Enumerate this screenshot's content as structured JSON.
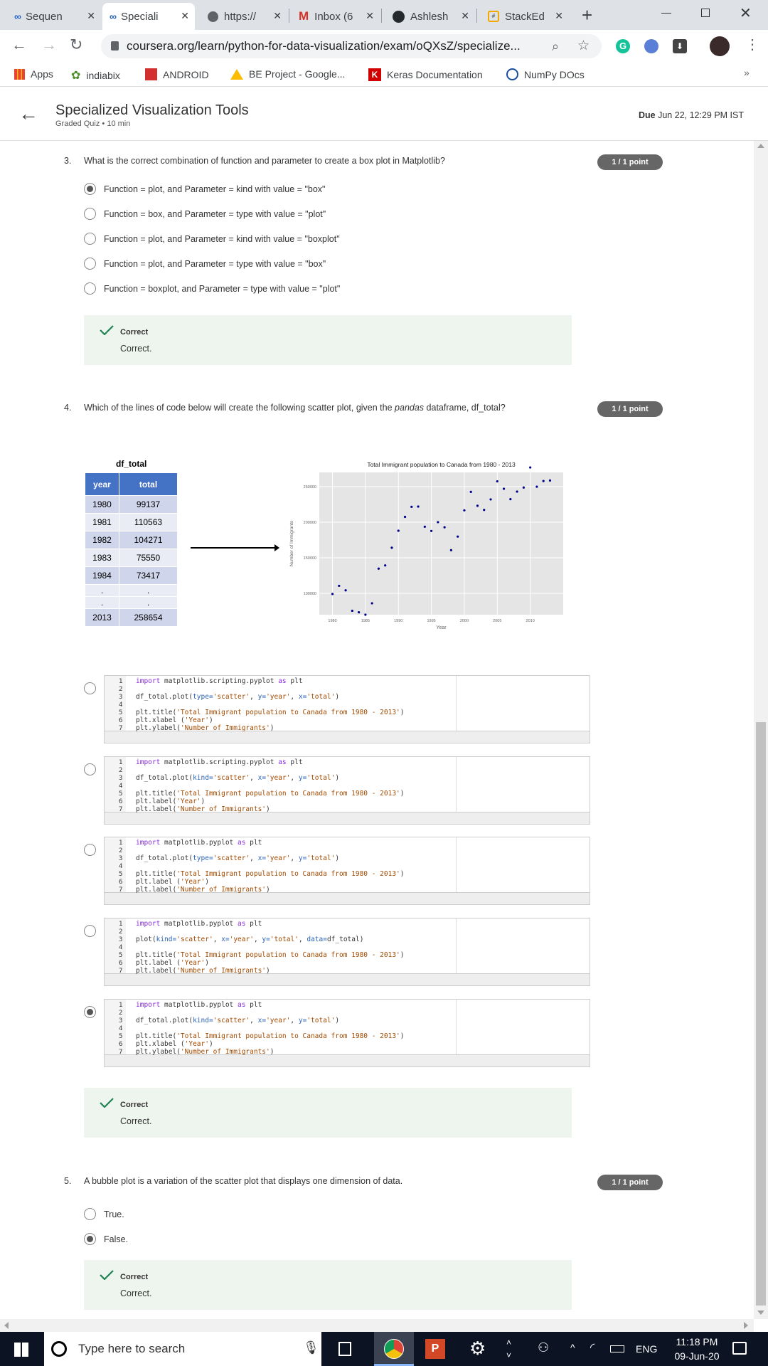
{
  "browser": {
    "tabs": [
      {
        "label": "Sequen",
        "icon": "coursera-icon"
      },
      {
        "label": "Speciali",
        "icon": "coursera-icon"
      },
      {
        "label": "https://",
        "icon": "globe-icon"
      },
      {
        "label": "Inbox (6",
        "icon": "gmail-icon"
      },
      {
        "label": "Ashlesh",
        "icon": "github-icon"
      },
      {
        "label": "StackEd",
        "icon": "stackedit-icon"
      }
    ],
    "url": "coursera.org/learn/python-for-data-visualization/exam/oQXsZ/specialize...",
    "bookmarks": [
      {
        "label": "Apps",
        "icon": "apps-grid-icon"
      },
      {
        "label": "indiabix",
        "icon": "indiabix-icon"
      },
      {
        "label": "ANDROID",
        "icon": "android-bookmark-icon"
      },
      {
        "label": "BE Project - Google...",
        "icon": "google-drive-icon"
      },
      {
        "label": "Keras Documentation",
        "icon": "keras-icon"
      },
      {
        "label": "NumPy DOcs",
        "icon": "numpy-icon"
      }
    ]
  },
  "header": {
    "title": "Specialized Visualization Tools",
    "subtitle": "Graded Quiz • 10 min",
    "due_label": "Due",
    "due_value": "Jun 22, 12:29 PM IST"
  },
  "q3": {
    "number": "3.",
    "text": "What is the correct combination of function and parameter to create a box plot in Matplotlib?",
    "badge": "1 / 1 point",
    "options": [
      "Function = plot, and Parameter = kind with value = \"box\"",
      "Function = box, and Parameter = type with value = \"plot\"",
      "Function = plot, and Parameter = kind with value = \"boxplot\"",
      "Function = plot, and Parameter = type with value = \"box\"",
      "Function = boxplot, and Parameter = type with value = \"plot\""
    ],
    "selected": 0,
    "feedback_title": "Correct",
    "feedback_detail": "Correct."
  },
  "q4": {
    "number": "4.",
    "text_pre": "Which of the lines of code below will create the following scatter plot, given the ",
    "text_em": "pandas",
    "text_post": " dataframe, df_total?",
    "badge": "1 / 1 point",
    "table": {
      "title": "df_total",
      "headers": [
        "year",
        "total"
      ],
      "rows": [
        [
          "1980",
          "99137"
        ],
        [
          "1981",
          "110563"
        ],
        [
          "1982",
          "104271"
        ],
        [
          "1983",
          "75550"
        ],
        [
          "1984",
          "73417"
        ]
      ],
      "ellipsis": "."
    },
    "last_row": [
      "2013",
      "258654"
    ],
    "selected": 4,
    "feedback_title": "Correct",
    "feedback_detail": "Correct.",
    "code_options": [
      [
        [
          [
            "kw",
            "import"
          ],
          [
            "t",
            " matplotlib.scripting.pyplot "
          ],
          [
            "kw",
            "as"
          ],
          [
            "t",
            " plt"
          ]
        ],
        [],
        [
          [
            "t",
            "df_total.plot("
          ],
          [
            "ar",
            "type="
          ],
          [
            "str",
            "'scatter'"
          ],
          [
            "t",
            ", "
          ],
          [
            "ar",
            "y="
          ],
          [
            "str",
            "'year'"
          ],
          [
            "t",
            ", "
          ],
          [
            "ar",
            "x="
          ],
          [
            "str",
            "'total'"
          ],
          [
            "t",
            ")"
          ]
        ],
        [],
        [
          [
            "t",
            "plt.title("
          ],
          [
            "str",
            "'Total Immigrant population to Canada from 1980 - 2013'"
          ],
          [
            "t",
            ")"
          ]
        ],
        [
          [
            "t",
            "plt.xlabel ("
          ],
          [
            "str",
            "'Year'"
          ],
          [
            "t",
            ")"
          ]
        ],
        [
          [
            "t",
            "plt.ylabel("
          ],
          [
            "str",
            "'Number of Immigrants'"
          ],
          [
            "t",
            ")"
          ]
        ]
      ],
      [
        [
          [
            "kw",
            "import"
          ],
          [
            "t",
            " matplotlib.scripting.pyplot "
          ],
          [
            "kw",
            "as"
          ],
          [
            "t",
            " plt"
          ]
        ],
        [],
        [
          [
            "t",
            "df_total.plot("
          ],
          [
            "ar",
            "kind="
          ],
          [
            "str",
            "'scatter'"
          ],
          [
            "t",
            ", "
          ],
          [
            "ar",
            "x="
          ],
          [
            "str",
            "'year'"
          ],
          [
            "t",
            ", "
          ],
          [
            "ar",
            "y="
          ],
          [
            "str",
            "'total'"
          ],
          [
            "t",
            ")"
          ]
        ],
        [],
        [
          [
            "t",
            "plt.title("
          ],
          [
            "str",
            "'Total Immigrant population to Canada from 1980 - 2013'"
          ],
          [
            "t",
            ")"
          ]
        ],
        [
          [
            "t",
            "plt.label("
          ],
          [
            "str",
            "'Year'"
          ],
          [
            "t",
            ")"
          ]
        ],
        [
          [
            "t",
            "plt.label("
          ],
          [
            "str",
            "'Number of Immigrants'"
          ],
          [
            "t",
            ")"
          ]
        ]
      ],
      [
        [
          [
            "kw",
            "import"
          ],
          [
            "t",
            " matplotlib.pyplot "
          ],
          [
            "kw",
            "as"
          ],
          [
            "t",
            " plt"
          ]
        ],
        [],
        [
          [
            "t",
            "df_total.plot("
          ],
          [
            "ar",
            "type="
          ],
          [
            "str",
            "'scatter'"
          ],
          [
            "t",
            ", "
          ],
          [
            "ar",
            "x="
          ],
          [
            "str",
            "'year'"
          ],
          [
            "t",
            ", "
          ],
          [
            "ar",
            "y="
          ],
          [
            "str",
            "'total'"
          ],
          [
            "t",
            ")"
          ]
        ],
        [],
        [
          [
            "t",
            "plt.title("
          ],
          [
            "str",
            "'Total Immigrant population to Canada from 1980 - 2013'"
          ],
          [
            "t",
            ")"
          ]
        ],
        [
          [
            "t",
            "plt.label ("
          ],
          [
            "str",
            "'Year'"
          ],
          [
            "t",
            ")"
          ]
        ],
        [
          [
            "t",
            "plt.label("
          ],
          [
            "str",
            "'Number of Immigrants'"
          ],
          [
            "t",
            ")"
          ]
        ]
      ],
      [
        [
          [
            "kw",
            "import"
          ],
          [
            "t",
            " matplotlib.pyplot "
          ],
          [
            "kw",
            "as"
          ],
          [
            "t",
            " plt"
          ]
        ],
        [],
        [
          [
            "t",
            "plot("
          ],
          [
            "ar",
            "kind="
          ],
          [
            "str",
            "'scatter'"
          ],
          [
            "t",
            ", "
          ],
          [
            "ar",
            "x="
          ],
          [
            "str",
            "'year'"
          ],
          [
            "t",
            ", "
          ],
          [
            "ar",
            "y="
          ],
          [
            "str",
            "'total'"
          ],
          [
            "t",
            ", "
          ],
          [
            "ar",
            "data="
          ],
          [
            "t",
            "df_total)"
          ]
        ],
        [],
        [
          [
            "t",
            "plt.title("
          ],
          [
            "str",
            "'Total Immigrant population to Canada from 1980 - 2013'"
          ],
          [
            "t",
            ")"
          ]
        ],
        [
          [
            "t",
            "plt.label ("
          ],
          [
            "str",
            "'Year'"
          ],
          [
            "t",
            ")"
          ]
        ],
        [
          [
            "t",
            "plt.label("
          ],
          [
            "str",
            "'Number of Immigrants'"
          ],
          [
            "t",
            ")"
          ]
        ]
      ],
      [
        [
          [
            "kw",
            "import"
          ],
          [
            "t",
            " matplotlib.pyplot "
          ],
          [
            "kw",
            "as"
          ],
          [
            "t",
            " plt"
          ]
        ],
        [],
        [
          [
            "t",
            "df_total.plot("
          ],
          [
            "ar",
            "kind="
          ],
          [
            "str",
            "'scatter'"
          ],
          [
            "t",
            ", "
          ],
          [
            "ar",
            "x="
          ],
          [
            "str",
            "'year'"
          ],
          [
            "t",
            ", "
          ],
          [
            "ar",
            "y="
          ],
          [
            "str",
            "'total'"
          ],
          [
            "t",
            ")"
          ]
        ],
        [],
        [
          [
            "t",
            "plt.title("
          ],
          [
            "str",
            "'Total Immigrant population to Canada from 1980 - 2013'"
          ],
          [
            "t",
            ")"
          ]
        ],
        [
          [
            "t",
            "plt.xlabel ("
          ],
          [
            "str",
            "'Year'"
          ],
          [
            "t",
            ")"
          ]
        ],
        [
          [
            "t",
            "plt.ylabel("
          ],
          [
            "str",
            "'Number of Immigrants'"
          ],
          [
            "t",
            ")"
          ]
        ]
      ]
    ]
  },
  "q5": {
    "number": "5.",
    "text": "A bubble plot is a variation of the scatter plot that displays one dimension of data.",
    "badge": "1 / 1 point",
    "options": [
      "True.",
      "False."
    ],
    "selected": 1,
    "feedback_title": "Correct",
    "feedback_detail": "Correct."
  },
  "chart_data": {
    "type": "scatter",
    "title": "Total Immigrant population to Canada from 1980 - 2013",
    "xlabel": "Year",
    "ylabel": "Number of Immigrants",
    "xlim": [
      1978,
      2015
    ],
    "ylim": [
      70000,
      270000
    ],
    "xticks": [
      1980,
      1985,
      1990,
      1995,
      2000,
      2005,
      2010
    ],
    "yticks": [
      100000,
      150000,
      200000,
      250000
    ],
    "grid": true,
    "point_color": "#00008b",
    "x": [
      1980,
      1981,
      1982,
      1983,
      1984,
      1985,
      1986,
      1987,
      1988,
      1989,
      1990,
      1991,
      1992,
      1993,
      1994,
      1995,
      1996,
      1997,
      1998,
      1999,
      2000,
      2001,
      2002,
      2003,
      2004,
      2005,
      2006,
      2007,
      2008,
      2009,
      2010,
      2011,
      2012,
      2013
    ],
    "y": [
      99137,
      110563,
      104271,
      75550,
      73417,
      69978,
      86048,
      134771,
      139306,
      164129,
      188054,
      207509,
      221687,
      222049,
      193665,
      187712,
      200085,
      192885,
      160727,
      179818,
      216712,
      242643,
      223111,
      217297,
      232083,
      257457,
      247057,
      232405,
      243047,
      248768,
      276956,
      249937,
      257903,
      258654
    ]
  },
  "taskbar": {
    "search_placeholder": "Type here to search",
    "time": "11:18 PM",
    "date": "09-Jun-20",
    "lang": "ENG"
  },
  "colors": {
    "badge_bg": "#666666",
    "correct_bg": "#eef5ef",
    "correct_check": "#1f8354",
    "table_header": "#4472c4"
  }
}
